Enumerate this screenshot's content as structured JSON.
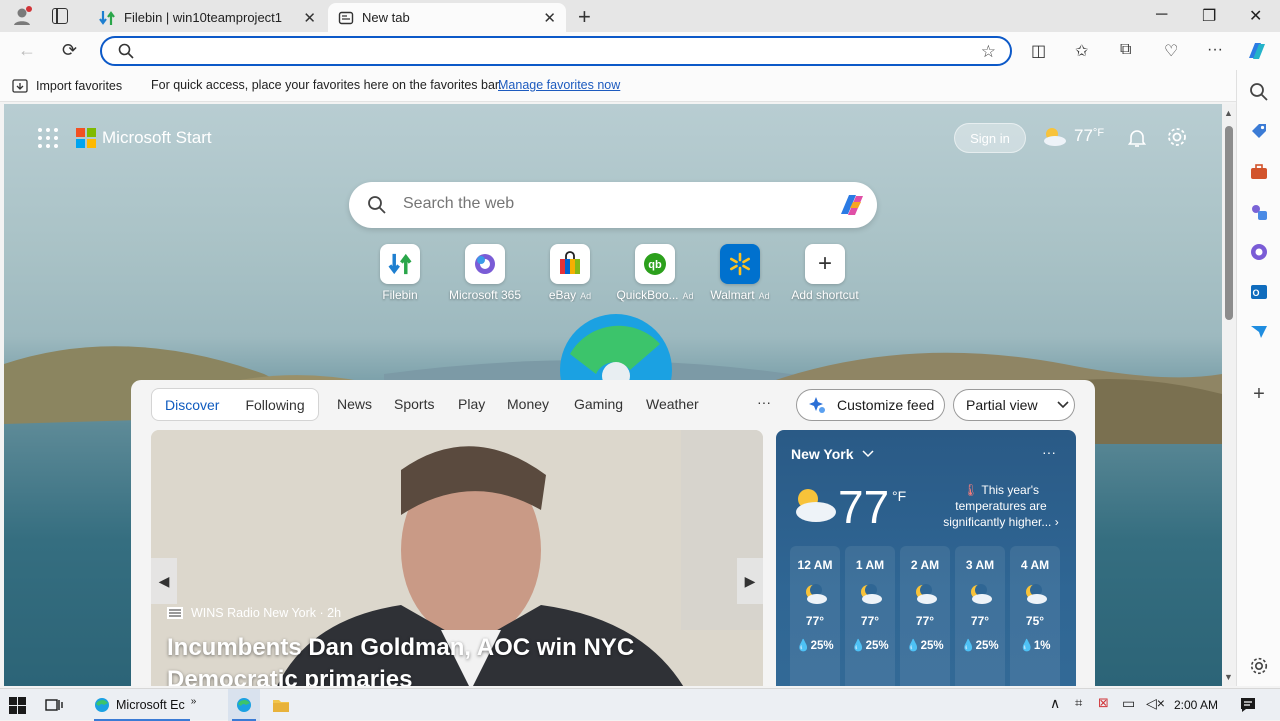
{
  "tabs": [
    {
      "title": "Filebin | win10teamproject1",
      "close": "✕"
    },
    {
      "title": "New tab",
      "close": "✕"
    }
  ],
  "window": {
    "new_tab": "+",
    "minimize": "─",
    "restore": "❐",
    "close": "✕"
  },
  "address_bar": {
    "value": "",
    "placeholder": ""
  },
  "favorites_bar": {
    "import_label": "Import favorites",
    "message": "For quick access, place your favorites here on the favorites bar.",
    "manage_link": "Manage favorites now"
  },
  "start": {
    "brand": "Microsoft Start",
    "sign_in": "Sign in",
    "weather_temp": "77",
    "weather_unit": "°F",
    "search_placeholder": "Search the web"
  },
  "shortcuts": [
    {
      "label": "Filebin",
      "ad": ""
    },
    {
      "label": "Microsoft 365",
      "ad": ""
    },
    {
      "label": "eBay",
      "ad": "Ad"
    },
    {
      "label": "QuickBoo...",
      "ad": "Ad"
    },
    {
      "label": "Walmart",
      "ad": "Ad"
    },
    {
      "label": "Add shortcut",
      "ad": ""
    }
  ],
  "feed": {
    "pills": [
      "Discover",
      "Following"
    ],
    "tabs": [
      "News",
      "Sports",
      "Play",
      "Money",
      "Gaming",
      "Weather"
    ],
    "more": "···",
    "customize": "Customize feed",
    "view": "Partial view"
  },
  "hero": {
    "source": "WINS Radio New York · 2h",
    "headline": "Incumbents Dan Goldman, AOC win NYC Democratic primaries"
  },
  "weather_card": {
    "city": "New York",
    "temp": "77",
    "unit": "°F",
    "note": "This year's temperatures are significantly higher...",
    "hours": [
      {
        "hour": "12 AM",
        "temp": "77°",
        "precip": "25%"
      },
      {
        "hour": "1 AM",
        "temp": "77°",
        "precip": "25%"
      },
      {
        "hour": "2 AM",
        "temp": "77°",
        "precip": "25%"
      },
      {
        "hour": "3 AM",
        "temp": "77°",
        "precip": "25%"
      },
      {
        "hour": "4 AM",
        "temp": "75°",
        "precip": "1%"
      }
    ]
  },
  "taskbar": {
    "edge_label": "Microsoft Ec",
    "clock": "2:00 AM"
  },
  "colors": {
    "accent": "#0f5bbf",
    "address_border": "#0c59c8",
    "weather_bg": "#2f6694"
  }
}
